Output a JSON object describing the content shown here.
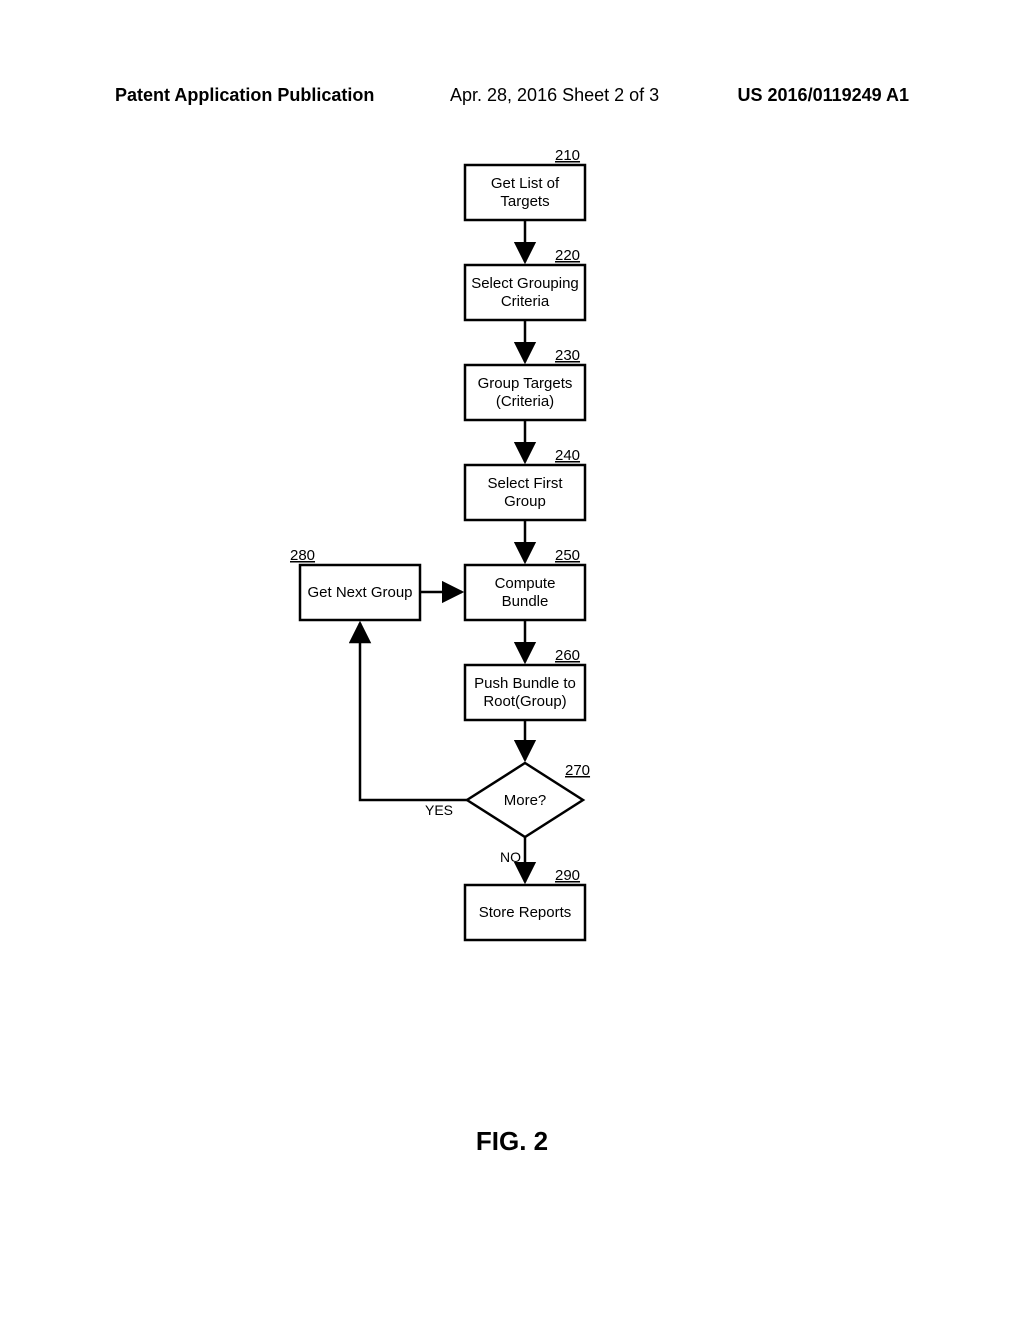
{
  "header": {
    "left": "Patent Application Publication",
    "center": "Apr. 28, 2016  Sheet 2 of 3",
    "right": "US 2016/0119249 A1"
  },
  "figure_label": "FIG. 2",
  "nodes": {
    "n210": {
      "ref": "210",
      "line1": "Get List of",
      "line2": "Targets"
    },
    "n220": {
      "ref": "220",
      "line1": "Select Grouping",
      "line2": "Criteria"
    },
    "n230": {
      "ref": "230",
      "line1": "Group Targets",
      "line2": "(Criteria)"
    },
    "n240": {
      "ref": "240",
      "line1": "Select First",
      "line2": "Group"
    },
    "n250": {
      "ref": "250",
      "line1": "Compute",
      "line2": "Bundle"
    },
    "n260": {
      "ref": "260",
      "line1": "Push Bundle to",
      "line2": "Root(Group)"
    },
    "n270": {
      "ref": "270",
      "line1": "More?"
    },
    "n280": {
      "ref": "280",
      "line1": "Get Next Group"
    },
    "n290": {
      "ref": "290",
      "line1": "Store Reports"
    }
  },
  "edges": {
    "yes": "YES",
    "no": "NO"
  }
}
